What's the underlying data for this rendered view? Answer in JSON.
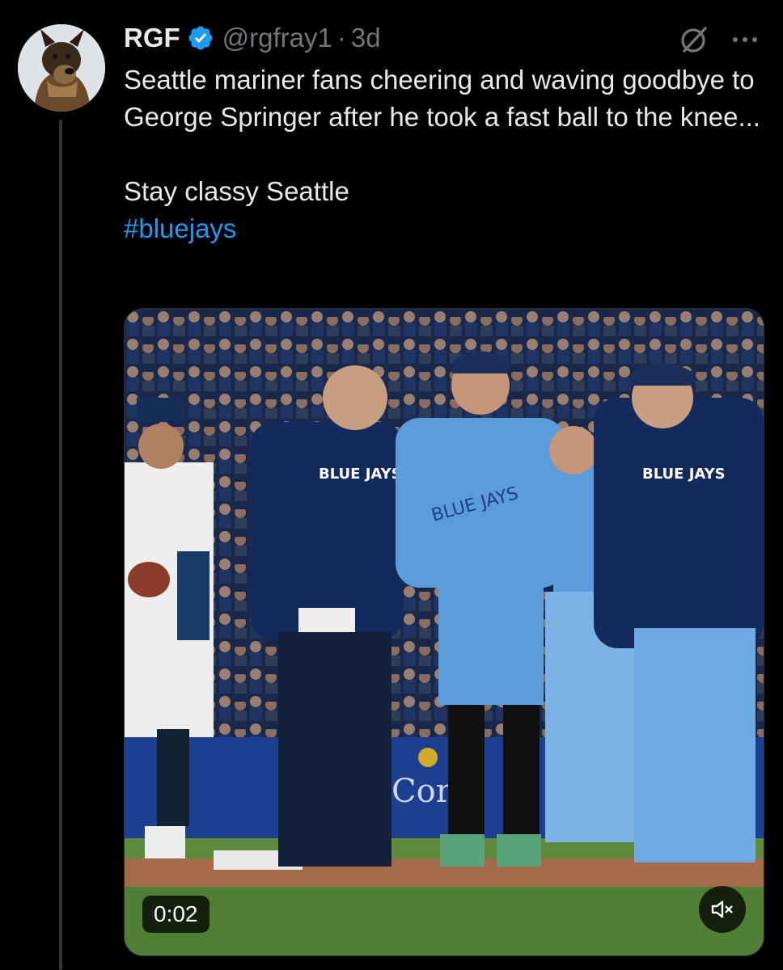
{
  "tweet": {
    "author": {
      "name": "RGF",
      "handle": "@rgfray1",
      "separator": "·",
      "time": "3d",
      "verified": true
    },
    "text": {
      "line1": "Seattle mariner fans cheering and waving goodbye to George Springer after he took a fast ball to the knee...",
      "line2": "Stay classy Seattle",
      "hashtag": "#bluejays"
    },
    "media": {
      "type": "video",
      "duration": "0:02",
      "muted": true
    }
  },
  "icons": {
    "verified": "verified-badge-icon",
    "grok": "grok-icon",
    "more": "more-options-icon",
    "mute": "volume-muted-icon"
  },
  "colors": {
    "background": "#000000",
    "text": "#e7e9ea",
    "secondary": "#71767b",
    "accent": "#1d9bf0"
  }
}
